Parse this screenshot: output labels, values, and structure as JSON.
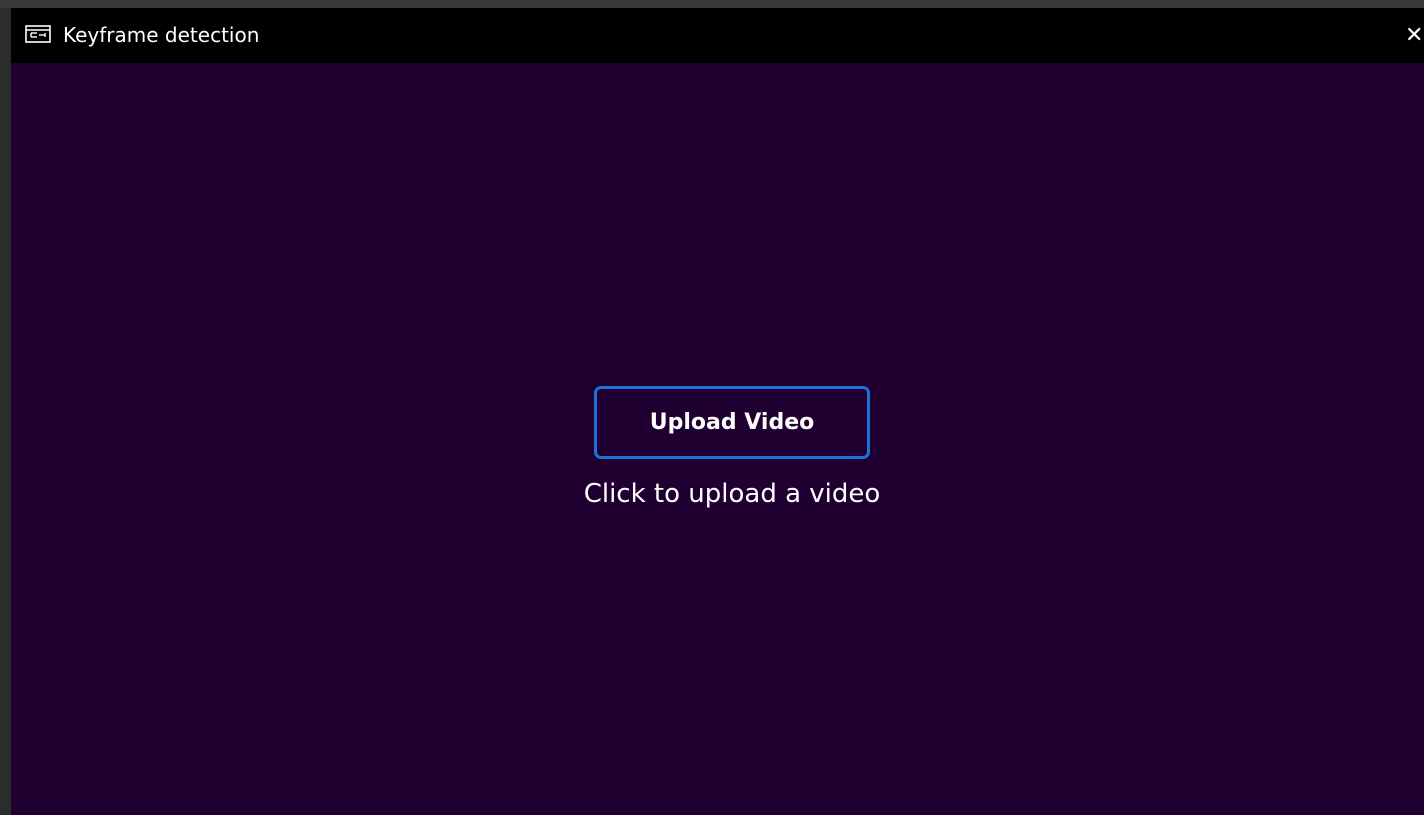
{
  "window": {
    "title": "Keyframe detection",
    "app_icon": "keyframe-app-icon",
    "close_glyph": "✕",
    "background_color": "#200030",
    "titlebar_color": "#000000"
  },
  "main": {
    "upload_button_label": "Upload Video",
    "upload_hint": "Click to upload a video",
    "accent_color": "#1e6fd6"
  }
}
